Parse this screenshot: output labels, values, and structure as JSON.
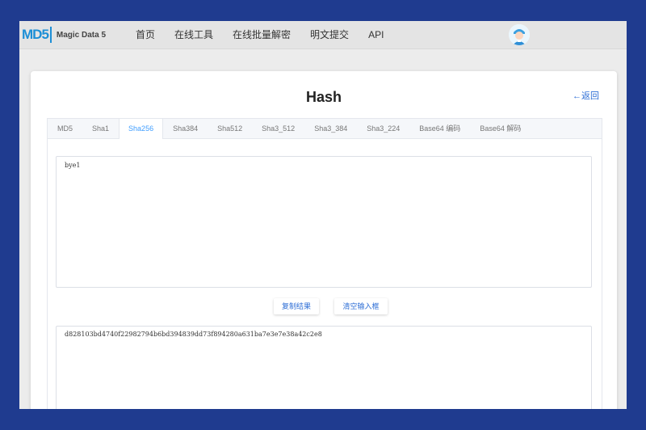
{
  "nav": {
    "logo_mark": "MD5",
    "logo_text": "Magic Data 5",
    "links": [
      "首页",
      "在线工具",
      "在线批量解密",
      "明文提交",
      "API"
    ]
  },
  "page": {
    "title": "Hash",
    "back_label": "←返回"
  },
  "tabs": [
    {
      "label": "MD5",
      "active": false
    },
    {
      "label": "Sha1",
      "active": false
    },
    {
      "label": "Sha256",
      "active": true
    },
    {
      "label": "Sha384",
      "active": false
    },
    {
      "label": "Sha512",
      "active": false
    },
    {
      "label": "Sha3_512",
      "active": false
    },
    {
      "label": "Sha3_384",
      "active": false
    },
    {
      "label": "Sha3_224",
      "active": false
    },
    {
      "label": "Base64 编码",
      "active": false
    },
    {
      "label": "Base64 解码",
      "active": false
    }
  ],
  "input": {
    "value": "bye1"
  },
  "buttons": {
    "copy_label": "复制结果",
    "clear_label": "清空输入框"
  },
  "output": {
    "value": "d828103bd4740f22982794b6bd394839dd73f894280a631ba7e3e7e38a42c2e8"
  },
  "colors": {
    "accent": "#409eff",
    "link": "#2f6fd6",
    "frame": "#1f3b8f"
  }
}
